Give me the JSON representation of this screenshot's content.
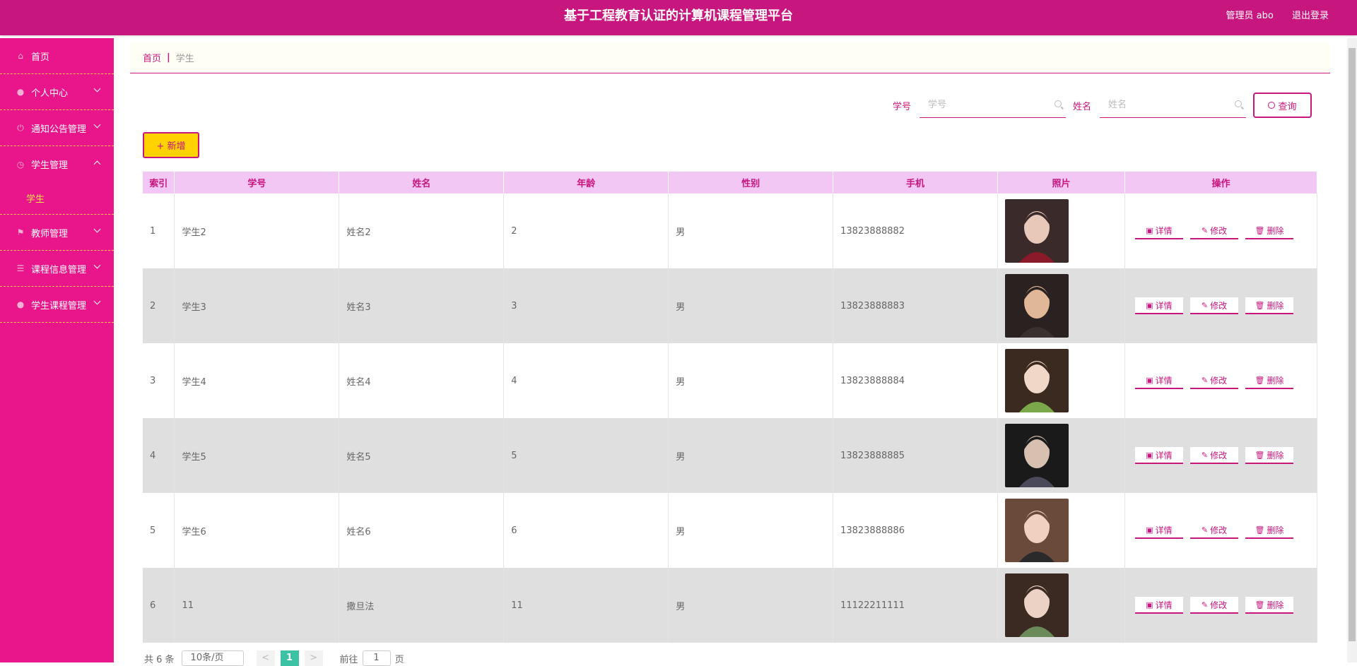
{
  "header": {
    "title": "基于工程教育认证的计算机课程管理平台",
    "admin_label": "管理员 abo",
    "logout_label": "退出登录"
  },
  "sidebar": {
    "items": [
      {
        "label": "首页",
        "icon": "home-icon"
      },
      {
        "label": "个人中心",
        "icon": "user-icon"
      },
      {
        "label": "通知公告管理",
        "icon": "power-icon"
      },
      {
        "label": "学生管理",
        "icon": "clock-icon"
      },
      {
        "label": "教师管理",
        "icon": "flag-icon"
      },
      {
        "label": "课程信息管理",
        "icon": "list-icon"
      },
      {
        "label": "学生课程管理",
        "icon": "user-icon"
      }
    ],
    "sub_student": "学生"
  },
  "breadcrumb": {
    "home": "首页",
    "sep": "|",
    "current": "学生"
  },
  "search": {
    "xuehao_label": "学号",
    "xuehao_placeholder": "学号",
    "xingming_label": "姓名",
    "xingming_placeholder": "姓名",
    "query_label": "查询"
  },
  "toolbar": {
    "add_label": "+ 新增"
  },
  "table": {
    "headers": [
      "索引",
      "学号",
      "姓名",
      "年龄",
      "性别",
      "手机",
      "照片",
      "操作"
    ],
    "rows": [
      {
        "index": "1",
        "xuehao": "学生2",
        "xingming": "姓名2",
        "age": "2",
        "gender": "男",
        "phone": "13823888882"
      },
      {
        "index": "2",
        "xuehao": "学生3",
        "xingming": "姓名3",
        "age": "3",
        "gender": "男",
        "phone": "13823888883"
      },
      {
        "index": "3",
        "xuehao": "学生4",
        "xingming": "姓名4",
        "age": "4",
        "gender": "男",
        "phone": "13823888884"
      },
      {
        "index": "4",
        "xuehao": "学生5",
        "xingming": "姓名5",
        "age": "5",
        "gender": "男",
        "phone": "13823888885"
      },
      {
        "index": "5",
        "xuehao": "学生6",
        "xingming": "姓名6",
        "age": "6",
        "gender": "男",
        "phone": "13823888886"
      },
      {
        "index": "6",
        "xuehao": "11",
        "xingming": "撒旦法",
        "age": "11",
        "gender": "男",
        "phone": "11122211111"
      }
    ],
    "ops": {
      "detail": "详情",
      "edit": "修改",
      "delete": "删除"
    }
  },
  "pager": {
    "total": "共 6 条",
    "page_size": "10条/页",
    "prev": "<",
    "current_page": "1",
    "next": ">",
    "goto_label": "前往",
    "goto_value": "1",
    "page_suffix": "页"
  },
  "colors": {
    "header_bg": "#c8167f",
    "sidebar_bg": "#e8168a",
    "accent": "#c8167f",
    "table_header_bg": "#f2c7f3",
    "add_button_bg": "#ffd200",
    "pager_active": "#3bc1a4"
  }
}
